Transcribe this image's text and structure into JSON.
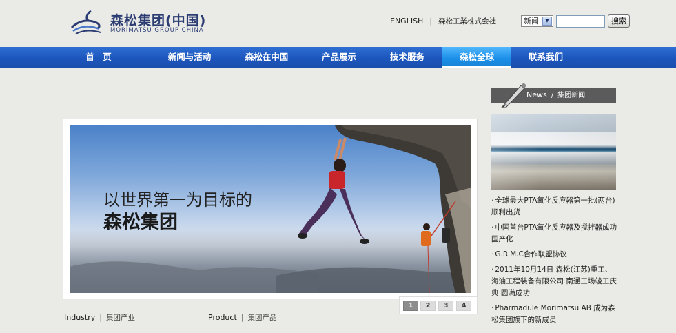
{
  "header": {
    "logo_cn": "森松集团(中国)",
    "logo_en": "MORIMATSU GROUP CHINA",
    "english_link": "ENGLISH",
    "separator": "|",
    "japan_link": "森松工業株式会社"
  },
  "search": {
    "select_value": "新闻",
    "input_value": "",
    "button_label": "搜索"
  },
  "nav": {
    "items": [
      {
        "label": "首　页"
      },
      {
        "label": "新闻与活动"
      },
      {
        "label": "森松在中国"
      },
      {
        "label": "产品展示"
      },
      {
        "label": "技术服务"
      },
      {
        "label": "森松全球",
        "active": true
      },
      {
        "label": "联系我们"
      }
    ]
  },
  "banner": {
    "line1": "以世界第一为目标的",
    "line2": "森松集团",
    "pages": [
      "1",
      "2",
      "3",
      "4"
    ],
    "current_page": "1"
  },
  "sections": {
    "industry": {
      "label": "Industry",
      "bar": "|",
      "sub": "集团产业"
    },
    "product": {
      "label": "Product",
      "bar": "|",
      "sub": "集团产品"
    }
  },
  "news": {
    "header_label": "News",
    "header_slash": "/",
    "header_sub": "集团新闻",
    "items": [
      {
        "text": "全球最大PTA氧化反应器第一批(两台)顺利出货"
      },
      {
        "text": "中国首台PTA氧化反应器及搅拌器成功国产化"
      },
      {
        "text": "G.R.M.C合作联盟协议"
      },
      {
        "text": "2011年10月14日 森松(江苏)重工、海油工程装备有限公司 南通工场竣工庆典 圆满成功"
      },
      {
        "text": "Pharmadule Morimatsu AB 成为森松集团旗下的新成员"
      }
    ],
    "bullet": "·"
  },
  "colors": {
    "nav_blue": "#1c56bc",
    "nav_active": "#1b8fe8",
    "logo_navy": "#2b3c73",
    "news_header_bg": "#5b5b5b",
    "page_bg": "#eaeae6"
  },
  "icons": {
    "logo": "morimatsu-wave-logo-icon",
    "select_arrow": "chevron-down-icon",
    "news_header": "pen-icon"
  }
}
